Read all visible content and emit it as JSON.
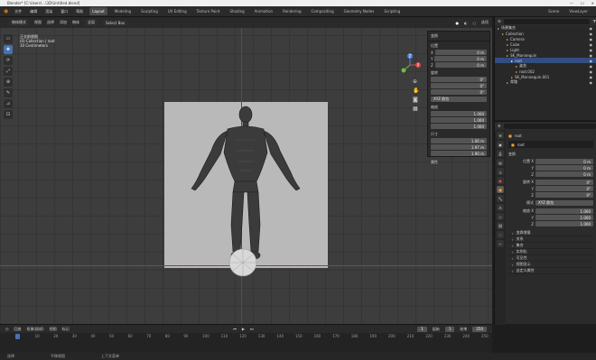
{
  "window": {
    "title": "Blender* [C:\\Users\\...\\3D\\Untitled.blend]",
    "controls": [
      "—",
      "☐",
      "✕"
    ]
  },
  "menu": {
    "items": [
      "文件",
      "编辑",
      "渲染",
      "窗口",
      "帮助"
    ],
    "workspaces": [
      "Layout",
      "Modeling",
      "Sculpting",
      "UV Editing",
      "Texture Paint",
      "Shading",
      "Animation",
      "Rendering",
      "Compositing",
      "Geometry Nodes",
      "Scripting"
    ],
    "active_workspace": "Layout",
    "scene_label": "Scene",
    "view_layer_label": "ViewLayer"
  },
  "viewport": {
    "header": {
      "mode": "物体模式",
      "view": "视图",
      "select": "选择",
      "add": "添加",
      "object": "物体",
      "pivot": "全局",
      "snap": "Select Box",
      "options": "选项"
    },
    "info_lines": [
      "正交前视图",
      "(0) Collection | root",
      "10 Centimeters"
    ],
    "tools": [
      "▭",
      "✥",
      "⟳",
      "⤢",
      "⊕",
      "✎",
      "⊿",
      "⊡"
    ],
    "gizmo_axes": [
      "X",
      "Y",
      "Z"
    ]
  },
  "npanel": {
    "section": "变换",
    "location_label": "位置",
    "location": [
      "0 m",
      "0 m",
      "0 m"
    ],
    "rotation_label": "旋转",
    "rotation": [
      "0°",
      "0°",
      "0°"
    ],
    "rotation_mode": "XYZ 欧拉",
    "scale_label": "缩放",
    "scale": [
      "1.000",
      "1.000",
      "1.000"
    ],
    "dims_label": "尺寸",
    "dims": [
      "1.06 m",
      "1.97 m",
      "1.90 m"
    ],
    "properties_label": "属性",
    "axes": [
      "X",
      "Y",
      "Z"
    ]
  },
  "outliner": {
    "search_placeholder": "",
    "items": [
      {
        "label": "场景集合",
        "indent": 0,
        "selected": false
      },
      {
        "label": "Collection",
        "indent": 1,
        "selected": false
      },
      {
        "label": "Camera",
        "indent": 2,
        "selected": false
      },
      {
        "label": "Cube",
        "indent": 2,
        "selected": false
      },
      {
        "label": "Light",
        "indent": 2,
        "selected": false
      },
      {
        "label": "SK_Mannequin",
        "indent": 2,
        "selected": false
      },
      {
        "label": "root",
        "indent": 3,
        "selected": true
      },
      {
        "label": "姿态",
        "indent": 4,
        "selected": false
      },
      {
        "label": "root.002",
        "indent": 4,
        "selected": false
      },
      {
        "label": "SK_Mannequin.001",
        "indent": 3,
        "selected": false
      },
      {
        "label": "骨骼",
        "indent": 2,
        "selected": false
      }
    ]
  },
  "properties": {
    "object_name": "root",
    "section_transform": "变换",
    "loc_label": "位置 X",
    "loc": [
      "0 m",
      "0 m",
      "0 m"
    ],
    "rot_label": "旋转 X",
    "rot": [
      "0°",
      "0°",
      "0°"
    ],
    "mode_label": "模式",
    "mode": "XYZ 欧拉",
    "scale_label": "缩放 X",
    "scale": [
      "1.000",
      "1.000",
      "1.000"
    ],
    "axis_y": "Y",
    "axis_z": "Z",
    "sections": [
      "变换增量",
      "关系",
      "集合",
      "实例化",
      "可见性",
      "视图显示",
      "自定义属性"
    ]
  },
  "timeline": {
    "playback": "回放",
    "keying": "抠像(插帧)",
    "view": "视图",
    "marker": "标记",
    "current_frame": "1",
    "start_label": "起始",
    "start": "1",
    "end_label": "结束",
    "end": "250",
    "ticks": [
      "0",
      "10",
      "20",
      "30",
      "40",
      "50",
      "60",
      "70",
      "80",
      "90",
      "100",
      "110",
      "120",
      "130",
      "140",
      "150",
      "160",
      "170",
      "180",
      "190",
      "200",
      "210",
      "220",
      "230",
      "240",
      "250"
    ]
  },
  "status": {
    "left": "选择",
    "middle": "平移视图",
    "right": "上下文菜单"
  }
}
